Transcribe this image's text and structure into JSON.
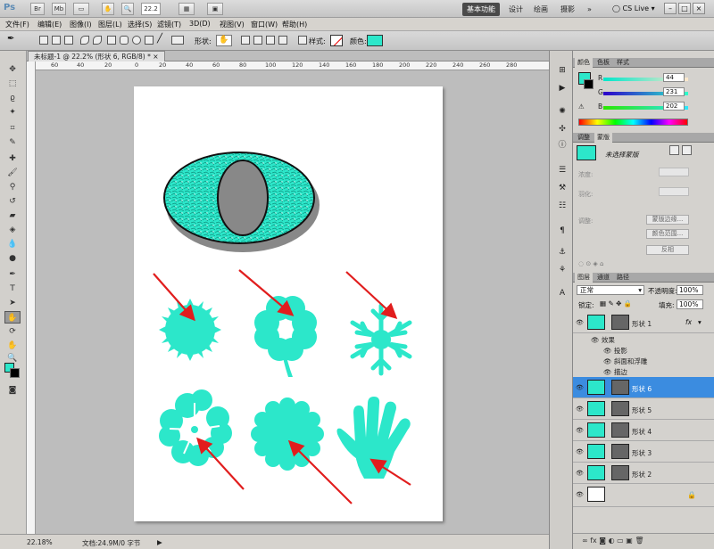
{
  "app_bar": {
    "logo": "Ps",
    "btn_br": "Br",
    "btn_mb": "Mb",
    "zoom_value": "22.2",
    "workspaces": [
      "基本功能",
      "设计",
      "绘画",
      "摄影"
    ],
    "more": "»",
    "cs_live": "CS Live",
    "window_buttons": [
      "–",
      "□",
      "×"
    ]
  },
  "menu": [
    "文件(F)",
    "编辑(E)",
    "图像(I)",
    "图层(L)",
    "选择(S)",
    "滤镜(T)",
    "3D(D)",
    "视图(V)",
    "窗口(W)",
    "帮助(H)"
  ],
  "options": {
    "shape_label": "形状:",
    "style_label": "样式:",
    "color_label": "颜色:",
    "accent": "#2ce7ca"
  },
  "document": {
    "tab_title": "未标题-1 @ 22.2% (形状 6, RGB/8) *",
    "ruler_ticks": [
      "60",
      "40",
      "20",
      "0",
      "20",
      "40",
      "60",
      "80",
      "100",
      "120",
      "140",
      "160",
      "180",
      "200",
      "220",
      "240",
      "260",
      "280"
    ]
  },
  "status": {
    "zoom": "22.18%",
    "doc": "文档:24.9M/0 字节"
  },
  "color_panel": {
    "tabs": [
      "颜色",
      "色板",
      "样式"
    ],
    "r_label": "R",
    "g_label": "G",
    "b_label": "B",
    "r": "44",
    "g": "231",
    "b": "202"
  },
  "adjust_panel": {
    "tabs": [
      "调整",
      "蒙版"
    ],
    "title": "未选择蒙版",
    "density": "浓度:",
    "feather": "羽化:",
    "refine": "调整:",
    "buttons": [
      "蒙版边缘...",
      "颜色范围...",
      "反相"
    ]
  },
  "layers_panel": {
    "tabs": [
      "图层",
      "通道",
      "路径"
    ],
    "blend_mode": "正常",
    "opacity_label": "不透明度:",
    "opacity": "100%",
    "lock_label": "锁定:",
    "fill_label": "填充:",
    "fill": "100%",
    "layers": [
      {
        "name": "形状 1",
        "fx": "fx"
      },
      {
        "name": "形状 6"
      },
      {
        "name": "形状 5"
      },
      {
        "name": "形状 4"
      },
      {
        "name": "形状 3"
      },
      {
        "name": "形状 2"
      }
    ],
    "effects_header": "效果",
    "effects": [
      "投影",
      "斜面和浮雕",
      "描边"
    ]
  }
}
